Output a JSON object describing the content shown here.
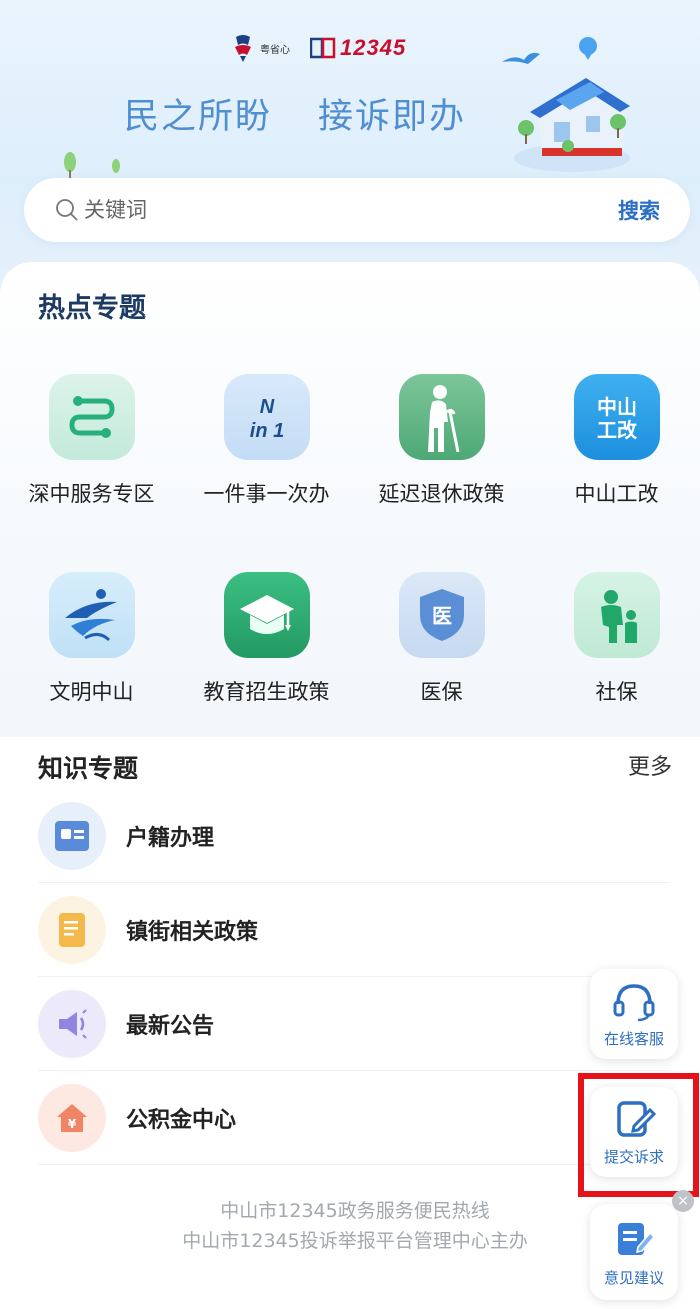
{
  "header": {
    "logo_left_text": "粤省心",
    "logo_right_text": "12345",
    "slogan_left": "民之所盼",
    "slogan_right": "接诉即办"
  },
  "search": {
    "placeholder": "关键词",
    "button_label": "搜索"
  },
  "hot_topics": {
    "title": "热点专题",
    "items": [
      {
        "label": "深中服务专区",
        "icon": "route-icon"
      },
      {
        "label": "一件事一次办",
        "icon": "n-in-1-icon"
      },
      {
        "label": "延迟退休政策",
        "icon": "elderly-icon"
      },
      {
        "label": "中山工改",
        "icon": "zhongshan-gonggai-icon",
        "icon_text": "中山工改"
      },
      {
        "label": "文明中山",
        "icon": "civilization-icon"
      },
      {
        "label": "教育招生政策",
        "icon": "graduation-cap-icon"
      },
      {
        "label": "医保",
        "icon": "medical-insurance-icon",
        "icon_text": "医"
      },
      {
        "label": "社保",
        "icon": "family-icon"
      }
    ]
  },
  "knowledge": {
    "title": "知识专题",
    "more_label": "更多",
    "items": [
      {
        "label": "户籍办理",
        "icon": "id-card-icon"
      },
      {
        "label": "镇街相关政策",
        "icon": "document-icon"
      },
      {
        "label": "最新公告",
        "icon": "megaphone-icon"
      },
      {
        "label": "公积金中心",
        "icon": "house-fund-icon"
      }
    ]
  },
  "footer": {
    "line1": "中山市12345政务服务便民热线",
    "line2": "中山市12345投诉举报平台管理中心主办"
  },
  "floating": {
    "online_service": "在线客服",
    "submit_request": "提交诉求",
    "feedback": "意见建议"
  },
  "colors": {
    "accent": "#2a6fc4",
    "slogan": "#4f8ed0",
    "highlight": "#e6131a"
  }
}
